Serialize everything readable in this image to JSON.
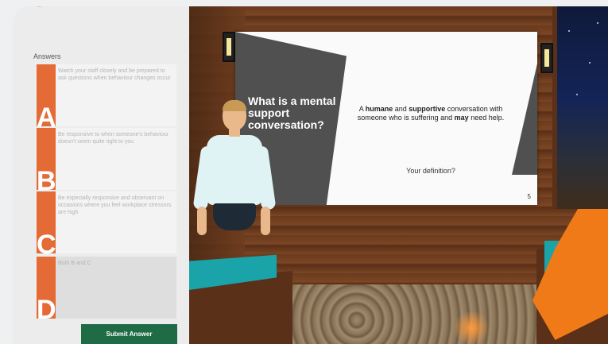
{
  "panel": {
    "top_text": "...",
    "answers_label": "Answers",
    "answers": [
      {
        "letter": "A",
        "text": "Watch your staff closely and be prepared to ask questions when behaviour changes occur"
      },
      {
        "letter": "B",
        "text": "Be responsive to when someone's behaviour doesn't seem quite right to you"
      },
      {
        "letter": "C",
        "text": "Be especially responsive and observant on occasions where you feel workplace stressors are high"
      },
      {
        "letter": "D",
        "text": "Both B and C"
      }
    ],
    "submit_label": "Submit Answer",
    "accent_color": "#e46a36",
    "submit_color": "#1f6b45"
  },
  "slide": {
    "question": "What is a mental support conversation?",
    "definition_parts": {
      "p1": "A ",
      "b1": "humane",
      "p2": " and ",
      "b2": "supportive",
      "p3": " conversation  with someone who is suffering and ",
      "b3": "may",
      "p4": " need help."
    },
    "prompt": "Your definition?",
    "page_number": "5"
  }
}
